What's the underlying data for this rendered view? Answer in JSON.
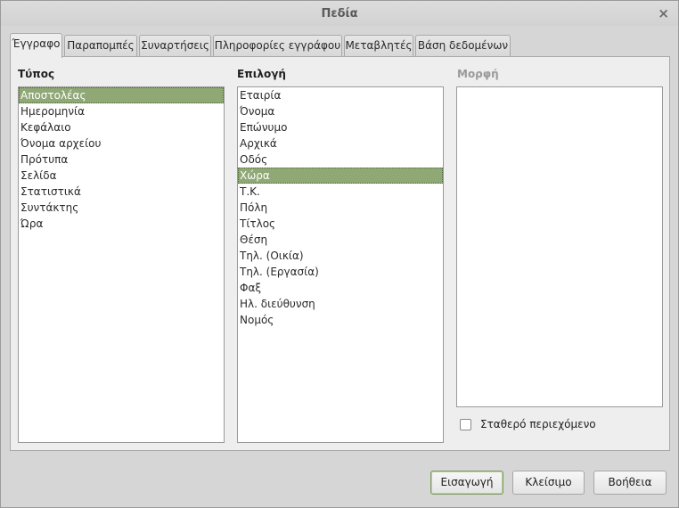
{
  "dialog": {
    "title": "Πεδία",
    "close_glyph": "×"
  },
  "tabs": [
    {
      "label": "Έγγραφο"
    },
    {
      "label": "Παραπομπές"
    },
    {
      "label": "Συναρτήσεις"
    },
    {
      "label": "Πληροφορίες εγγράφου"
    },
    {
      "label": "Μεταβλητές"
    },
    {
      "label": "Βάση δεδομένων"
    }
  ],
  "active_tab": "Έγγραφο",
  "type_column": {
    "label": "Τύπος",
    "items": [
      {
        "label": "Αποστολέας"
      },
      {
        "label": "Ημερομηνία"
      },
      {
        "label": "Κεφάλαιο"
      },
      {
        "label": "Όνομα αρχείου"
      },
      {
        "label": "Πρότυπα"
      },
      {
        "label": "Σελίδα"
      },
      {
        "label": "Στατιστικά"
      },
      {
        "label": "Συντάκτης"
      },
      {
        "label": "Ώρα"
      }
    ],
    "selected": "Αποστολέας"
  },
  "select_column": {
    "label": "Επιλογή",
    "items": [
      {
        "label": "Εταιρία"
      },
      {
        "label": "Όνομα"
      },
      {
        "label": "Επώνυμο"
      },
      {
        "label": "Αρχικά"
      },
      {
        "label": "Οδός"
      },
      {
        "label": "Χώρα"
      },
      {
        "label": "Τ.Κ."
      },
      {
        "label": "Πόλη"
      },
      {
        "label": "Τίτλος"
      },
      {
        "label": "Θέση"
      },
      {
        "label": "Τηλ. (Οικία)"
      },
      {
        "label": "Τηλ. (Εργασία)"
      },
      {
        "label": "Φαξ"
      },
      {
        "label": "Ηλ. διεύθυνση"
      },
      {
        "label": "Νομός"
      }
    ],
    "selected": "Χώρα"
  },
  "format_column": {
    "label": "Μορφή"
  },
  "fixed_content": {
    "label": "Σταθερό περιεχόμενο",
    "checked": false
  },
  "buttons": {
    "insert": "Εισαγωγή",
    "close": "Κλείσιμο",
    "help": "Βοήθεια"
  },
  "colors": {
    "selection": "#8fa876",
    "default_button_border": "#7e9b61",
    "window_bg": "#d6d6d6",
    "panel_bg": "#eeeeee"
  }
}
